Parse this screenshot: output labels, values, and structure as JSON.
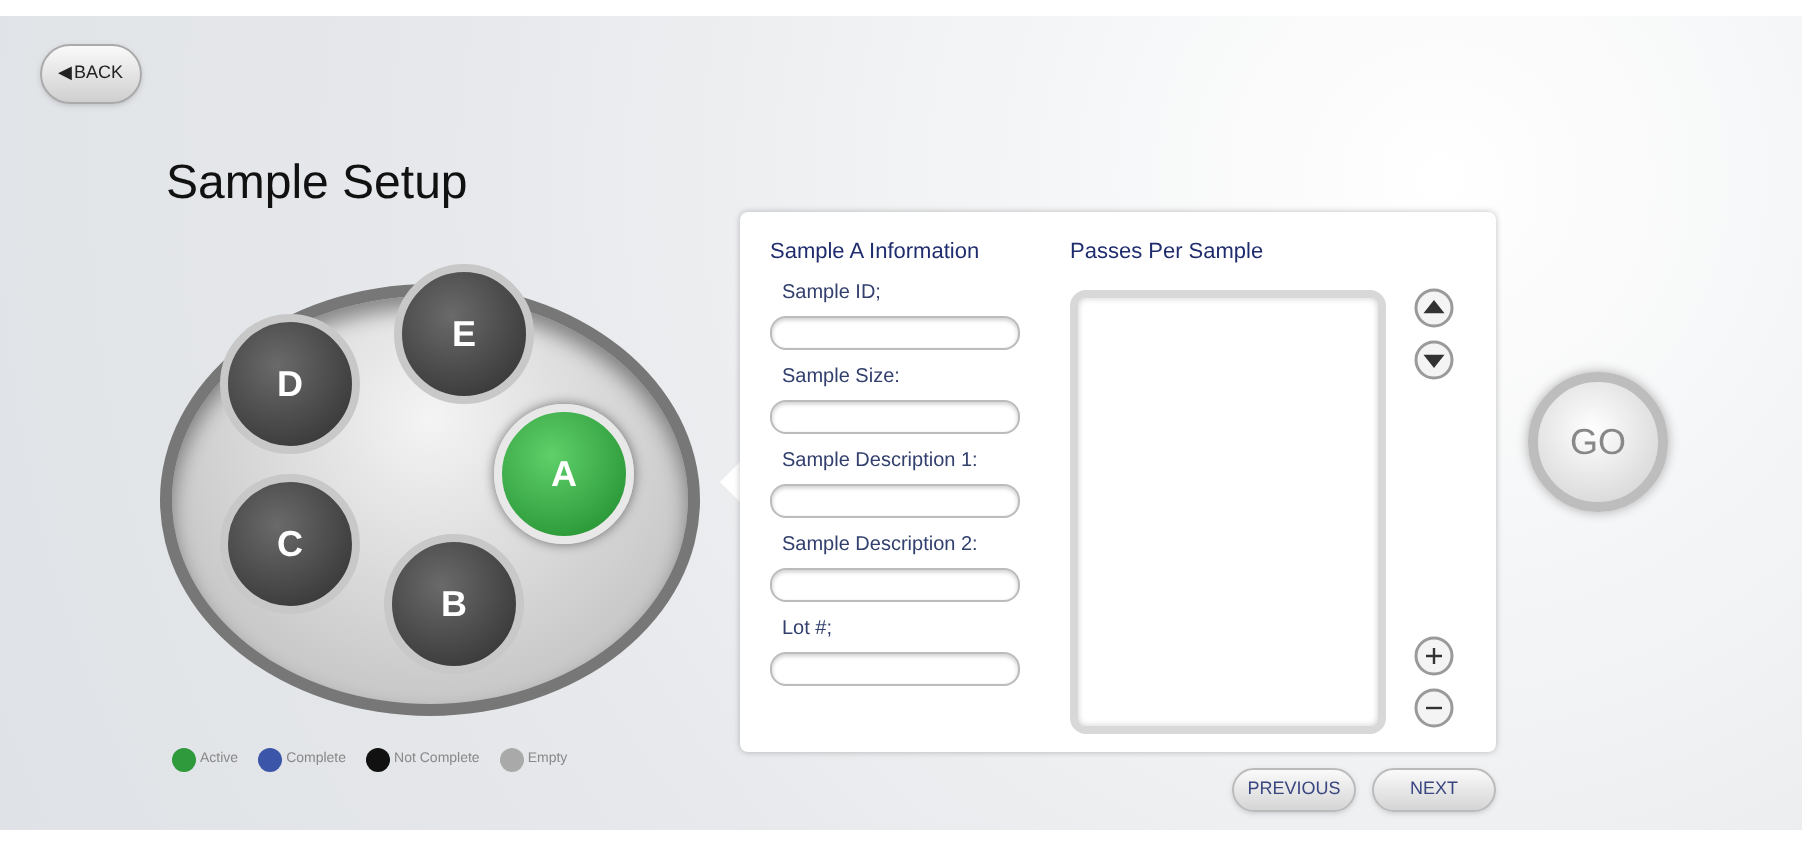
{
  "back_button": {
    "arrow": "◀",
    "label": "BACK"
  },
  "title": "Sample Setup",
  "samples": [
    {
      "label": "E",
      "kind": "incomplete",
      "selected": false
    },
    {
      "label": "D",
      "kind": "incomplete",
      "selected": false
    },
    {
      "label": "A",
      "kind": "active",
      "selected": true
    },
    {
      "label": "C",
      "kind": "incomplete",
      "selected": false
    },
    {
      "label": "B",
      "kind": "incomplete",
      "selected": false
    }
  ],
  "legend": [
    {
      "label": "Active",
      "color": "#2e9a3c"
    },
    {
      "label": "Complete",
      "color": "#3b55a8"
    },
    {
      "label": "Not Complete",
      "color": "#111111"
    },
    {
      "label": "Empty",
      "color": "#a9a9a9"
    }
  ],
  "info": {
    "title": "Sample A Information",
    "fields": [
      {
        "label": "Sample ID;"
      },
      {
        "label": "Sample Size:"
      },
      {
        "label": "Sample Description 1:"
      },
      {
        "label": "Sample Description 2:"
      },
      {
        "label": "Lot #;"
      }
    ]
  },
  "passes": {
    "title": "Passes Per Sample"
  },
  "go_button": "GO",
  "nav_buttons": [
    "PREVIOUS",
    "NEXT"
  ]
}
